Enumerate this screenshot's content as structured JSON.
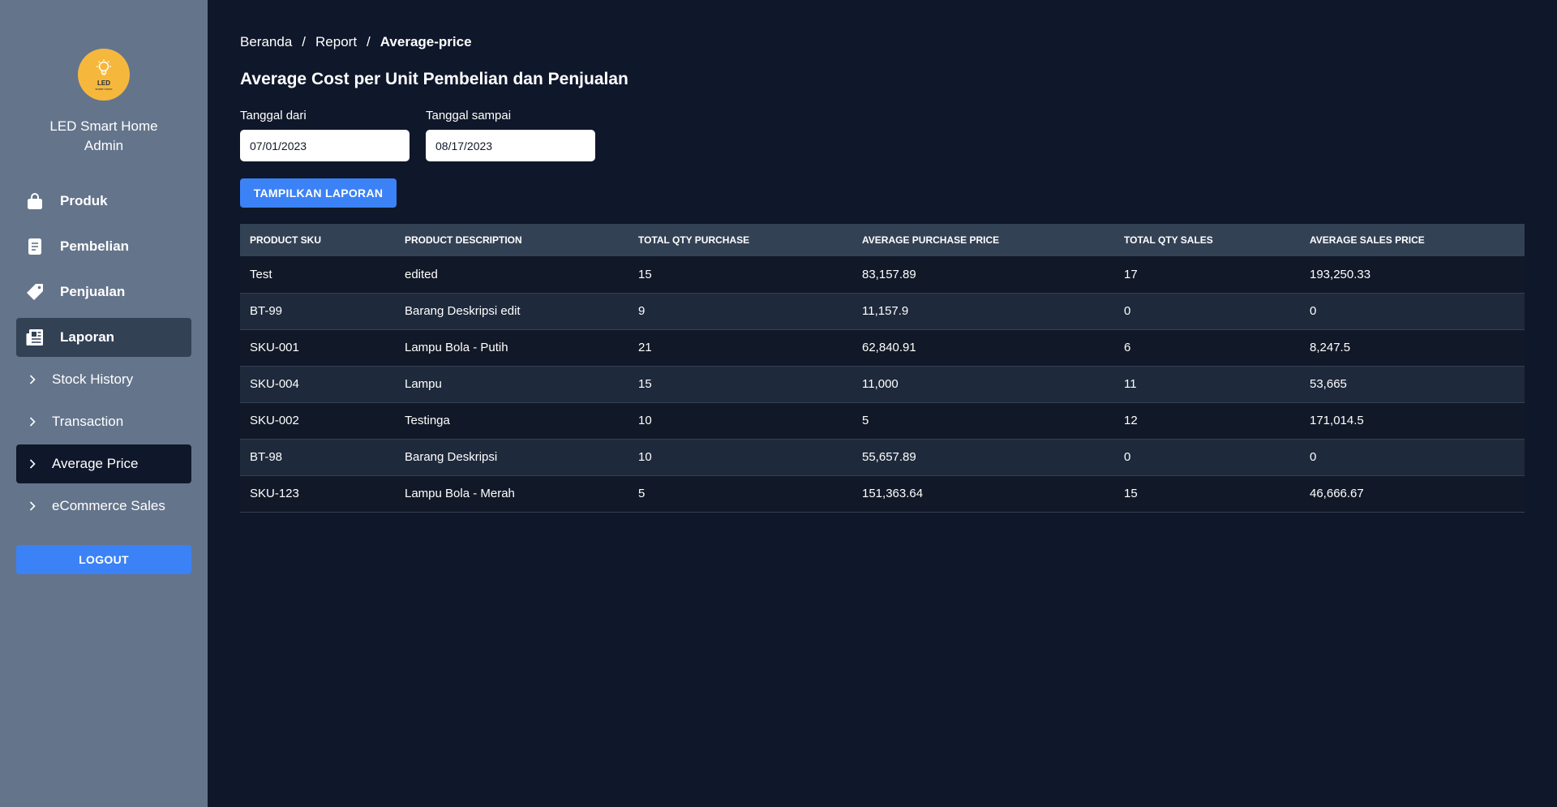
{
  "sidebar": {
    "logo": {
      "text": "LED",
      "subtext": "smart home"
    },
    "app_name_line1": "LED Smart Home",
    "app_name_line2": "Admin",
    "nav": [
      {
        "label": "Produk",
        "icon": "shopping-bag-icon"
      },
      {
        "label": "Pembelian",
        "icon": "receipt-icon"
      },
      {
        "label": "Penjualan",
        "icon": "tag-icon"
      },
      {
        "label": "Laporan",
        "icon": "newspaper-icon",
        "active": true
      }
    ],
    "subnav": [
      {
        "label": "Stock History",
        "icon": "chevron-right-icon"
      },
      {
        "label": "Transaction",
        "icon": "chevron-right-icon"
      },
      {
        "label": "Average Price",
        "icon": "chevron-right-icon",
        "active": true
      },
      {
        "label": "eCommerce Sales",
        "icon": "chevron-right-icon"
      }
    ],
    "logout_label": "LOGOUT"
  },
  "breadcrumb": {
    "items": [
      "Beranda",
      "Report",
      "Average-price"
    ],
    "separator": "/"
  },
  "page_title": "Average Cost per Unit Pembelian dan Penjualan",
  "filters": {
    "date_from_label": "Tanggal dari",
    "date_from_value": "07/01/2023",
    "date_to_label": "Tanggal sampai",
    "date_to_value": "08/17/2023",
    "submit_label": "TAMPILKAN LAPORAN"
  },
  "table": {
    "headers": [
      "Product SKU",
      "Product Description",
      "Total Qty Purchase",
      "Average Purchase Price",
      "Total Qty Sales",
      "Average Sales Price"
    ],
    "rows": [
      [
        "Test",
        "edited",
        "15",
        "83,157.89",
        "17",
        "193,250.33"
      ],
      [
        "BT-99",
        "Barang Deskripsi edit",
        "9",
        "11,157.9",
        "0",
        "0"
      ],
      [
        "SKU-001",
        "Lampu Bola - Putih",
        "21",
        "62,840.91",
        "6",
        "8,247.5"
      ],
      [
        "SKU-004",
        "Lampu",
        "15",
        "11,000",
        "11",
        "53,665"
      ],
      [
        "SKU-002",
        "Testinga",
        "10",
        "5",
        "12",
        "171,014.5"
      ],
      [
        "BT-98",
        "Barang Deskripsi",
        "10",
        "55,657.89",
        "0",
        "0"
      ],
      [
        "SKU-123",
        "Lampu Bola - Merah",
        "5",
        "151,363.64",
        "15",
        "46,666.67"
      ]
    ]
  },
  "colors": {
    "background": "#0f172a",
    "sidebar": "#64748b",
    "accent": "#3b82f6",
    "logo": "#f5b83d",
    "table_header": "#334155"
  }
}
